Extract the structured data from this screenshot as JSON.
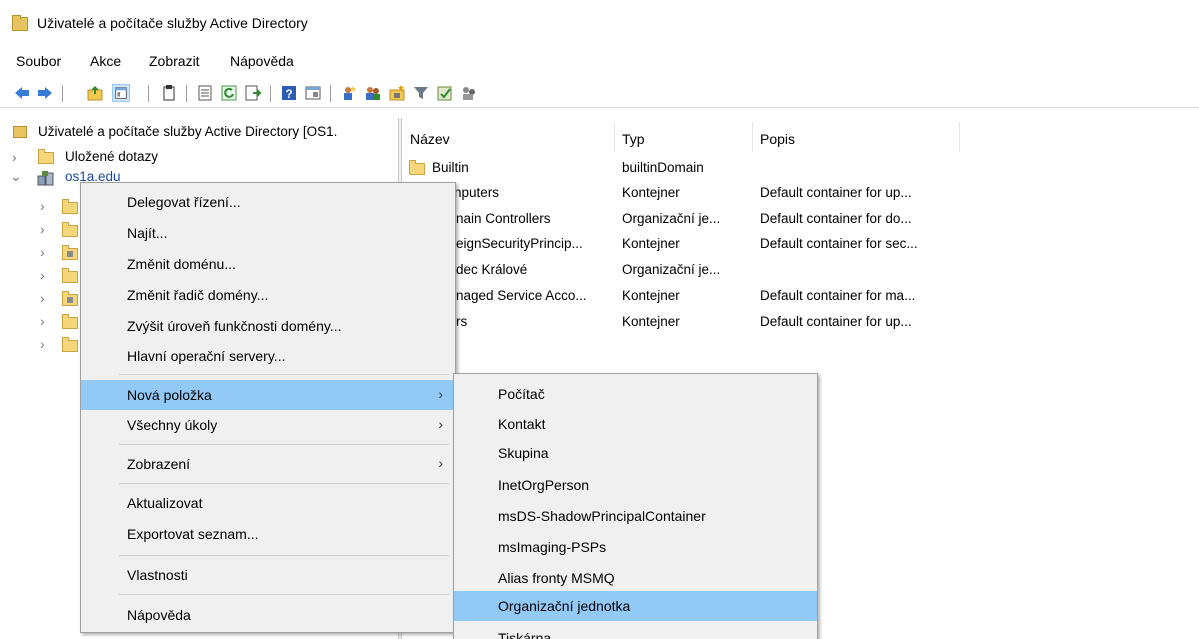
{
  "window": {
    "title": "Uživatelé a počítače služby Active Directory"
  },
  "menubar": [
    "Soubor",
    "Akce",
    "Zobrazit",
    "Nápověda"
  ],
  "tree": {
    "root_label": "Uživatelé a počítače služby Active Directory [OS1.",
    "saved_queries": "Uložené dotazy",
    "domain": "os1a.edu"
  },
  "list": {
    "columns": [
      "Název",
      "Typ",
      "Popis"
    ],
    "rows": [
      {
        "name": "Builtin",
        "type": "builtinDomain",
        "desc": ""
      },
      {
        "name": "nputers",
        "type": "Kontejner",
        "desc": "Default container for up..."
      },
      {
        "name": "nain Controllers",
        "type": "Organizační je...",
        "desc": "Default container for do..."
      },
      {
        "name": "eignSecurityPrincip...",
        "type": "Kontejner",
        "desc": "Default container for sec..."
      },
      {
        "name": "dec Králové",
        "type": "Organizační je...",
        "desc": ""
      },
      {
        "name": "naged Service Acco...",
        "type": "Kontejner",
        "desc": "Default container for ma..."
      },
      {
        "name": "rs",
        "type": "Kontejner",
        "desc": "Default container for up..."
      }
    ]
  },
  "context_menu": {
    "items": [
      "Delegovat řízení...",
      "Najít...",
      "Změnit doménu...",
      "Změnit řadič domény...",
      "Zvýšit úroveň funkčnosti domény...",
      "Hlavní operační servery...",
      "Nová položka",
      "Všechny úkoly",
      "Zobrazení",
      "Aktualizovat",
      "Exportovat seznam...",
      "Vlastnosti",
      "Nápověda"
    ],
    "highlighted": "Nová položka"
  },
  "submenu": {
    "items": [
      "Počítač",
      "Kontakt",
      "Skupina",
      "InetOrgPerson",
      "msDS-ShadowPrincipalContainer",
      "msImaging-PSPs",
      "Alias fronty MSMQ",
      "Organizační jednotka",
      "Tiskárna"
    ],
    "highlighted": "Organizační jednotka"
  },
  "colors": {
    "highlight": "#91c9f7",
    "menu_bg": "#f0f0f0",
    "folder": "#f5d67a"
  }
}
